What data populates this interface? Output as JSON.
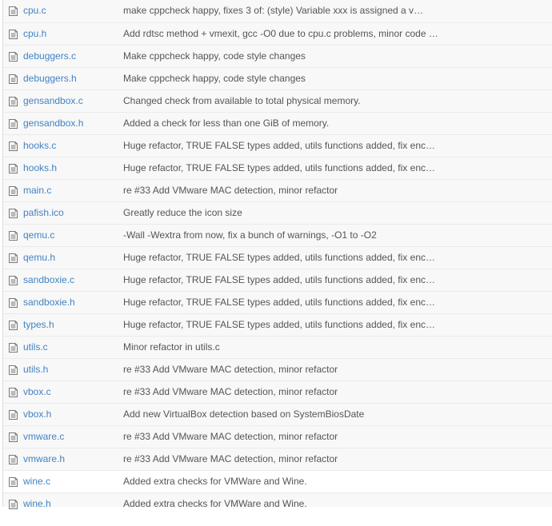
{
  "files": [
    {
      "name": "cpu.c",
      "message": "make cppcheck happy, fixes 3 of: (style) Variable xxx is assigned a v…"
    },
    {
      "name": "cpu.h",
      "message": "Add rdtsc method + vmexit, gcc -O0 due to cpu.c problems, minor code …"
    },
    {
      "name": "debuggers.c",
      "message": "Make cppcheck happy, code style changes"
    },
    {
      "name": "debuggers.h",
      "message": "Make cppcheck happy, code style changes"
    },
    {
      "name": "gensandbox.c",
      "message": "Changed check from available to total physical memory."
    },
    {
      "name": "gensandbox.h",
      "message": "Added a check for less than one GiB of memory."
    },
    {
      "name": "hooks.c",
      "message": "Huge refactor, TRUE FALSE types added, utils functions added, fix enc…"
    },
    {
      "name": "hooks.h",
      "message": "Huge refactor, TRUE FALSE types added, utils functions added, fix enc…"
    },
    {
      "name": "main.c",
      "message": "re #33 Add VMware MAC detection, minor refactor"
    },
    {
      "name": "pafish.ico",
      "message": "Greatly reduce the icon size"
    },
    {
      "name": "qemu.c",
      "message": "-Wall -Wextra from now, fix a bunch of warnings, -O1 to -O2"
    },
    {
      "name": "qemu.h",
      "message": "Huge refactor, TRUE FALSE types added, utils functions added, fix enc…"
    },
    {
      "name": "sandboxie.c",
      "message": "Huge refactor, TRUE FALSE types added, utils functions added, fix enc…"
    },
    {
      "name": "sandboxie.h",
      "message": "Huge refactor, TRUE FALSE types added, utils functions added, fix enc…"
    },
    {
      "name": "types.h",
      "message": "Huge refactor, TRUE FALSE types added, utils functions added, fix enc…"
    },
    {
      "name": "utils.c",
      "message": "Minor refactor in utils.c"
    },
    {
      "name": "utils.h",
      "message": "re #33 Add VMware MAC detection, minor refactor"
    },
    {
      "name": "vbox.c",
      "message": "re #33 Add VMware MAC detection, minor refactor"
    },
    {
      "name": "vbox.h",
      "message": "Add new VirtualBox detection based on SystemBiosDate"
    },
    {
      "name": "vmware.c",
      "message": "re #33 Add VMware MAC detection, minor refactor"
    },
    {
      "name": "vmware.h",
      "message": "re #33 Add VMware MAC detection, minor refactor"
    },
    {
      "name": "wine.c",
      "message": "Added extra checks for VMWare and Wine."
    },
    {
      "name": "wine.h",
      "message": "Added extra checks for VMWare and Wine."
    }
  ],
  "colors": {
    "link": "#4183c4",
    "message": "#555555",
    "row_bg": "#f8f8f8",
    "row_border": "#eaeaea"
  },
  "icon": "file-text-icon"
}
